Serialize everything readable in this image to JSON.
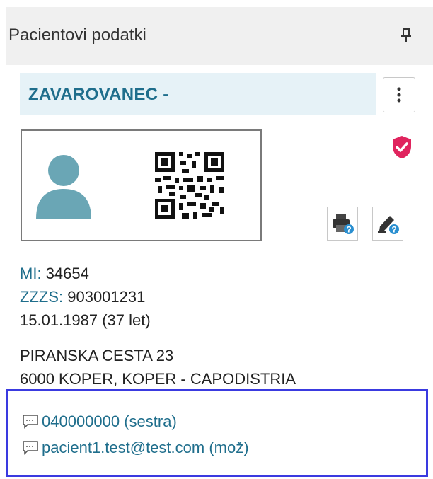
{
  "header": {
    "title": "Pacientovi podatki",
    "pin_icon": "pin-icon"
  },
  "patient": {
    "role_title": "ZAVAROVANEC -",
    "menu_icon": "more-vertical-icon",
    "avatar_icon": "person-icon",
    "qr_icon": "qr-code-icon",
    "shield_icon": "shield-check-icon",
    "shield_color": "#e0245e",
    "print_icon": "printer-info-icon",
    "edit_icon": "pen-info-icon",
    "mi_label": "MI:",
    "mi_value": "34654",
    "zzzs_label": "ZZZS:",
    "zzzs_value": "903001231",
    "birth": "15.01.1987 (37 let)",
    "address_line1": "PIRANSKA CESTA 23",
    "address_line2": "6000 KOPER, KOPER - CAPODISTRIA"
  },
  "contacts": [
    {
      "icon": "message-icon",
      "text": "040000000 (sestra)"
    },
    {
      "icon": "message-icon",
      "text": "pacient1.test@test.com (mož)"
    }
  ],
  "colors": {
    "accent": "#1f6e8c",
    "avatar": "#6aa6b5",
    "info_badge": "#2a8fd0",
    "focus_border": "#3a3ae0"
  }
}
